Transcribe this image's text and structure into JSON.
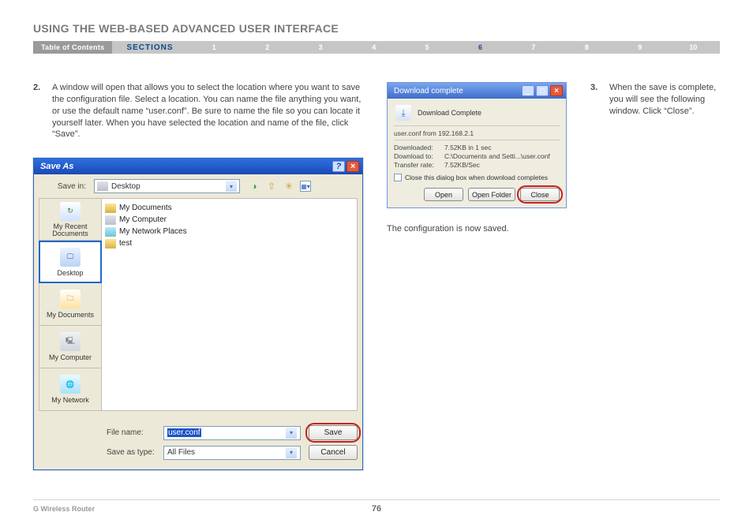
{
  "page": {
    "title": "USING THE WEB-BASED ADVANCED USER INTERFACE",
    "product": "G Wireless Router",
    "number": "76"
  },
  "nav": {
    "toc": "Table of Contents",
    "sections": "SECTIONS",
    "items": [
      "1",
      "2",
      "3",
      "4",
      "5",
      "6",
      "7",
      "8",
      "9",
      "10"
    ],
    "active_index": 5
  },
  "step2": {
    "n": "2.",
    "text": "A window will open that allows you to select the location where you want to save the configuration file. Select a location. You can name the file anything you want, or use the default name “user.conf”. Be sure to name the file so you can locate it yourself later. When you have selected the location and name of the file, click “Save”."
  },
  "save_as": {
    "title": "Save As",
    "save_in_label": "Save in:",
    "save_in_value": "Desktop",
    "toolbar_icons": [
      "back-icon",
      "up-icon",
      "new-folder-icon",
      "views-icon"
    ],
    "places": [
      {
        "label": "My Recent Documents"
      },
      {
        "label": "Desktop"
      },
      {
        "label": "My Documents"
      },
      {
        "label": "My Computer"
      },
      {
        "label": "My Network"
      }
    ],
    "files": [
      {
        "icon": "folder",
        "name": "My Documents"
      },
      {
        "icon": "computer",
        "name": "My Computer"
      },
      {
        "icon": "network",
        "name": "My Network Places"
      },
      {
        "icon": "folder",
        "name": "test"
      }
    ],
    "filename_label": "File name:",
    "filename_value": "user.conf",
    "savetype_label": "Save as type:",
    "savetype_value": "All Files",
    "save_btn": "Save",
    "cancel_btn": "Cancel"
  },
  "download": {
    "title": "Download complete",
    "header": "Download Complete",
    "source": "user.conf from 192.168.2.1",
    "rows": [
      {
        "k": "Downloaded:",
        "v": "7.52KB in 1 sec"
      },
      {
        "k": "Download to:",
        "v": "C:\\Documents and Setti...\\user.conf"
      },
      {
        "k": "Transfer rate:",
        "v": "7.52KB/Sec"
      }
    ],
    "checkbox": "Close this dialog box when download completes",
    "open": "Open",
    "open_folder": "Open Folder",
    "close": "Close"
  },
  "caption": "The configuration is now saved.",
  "step3": {
    "n": "3.",
    "text": "When the save is complete, you will see the following window. Click “Close”."
  }
}
